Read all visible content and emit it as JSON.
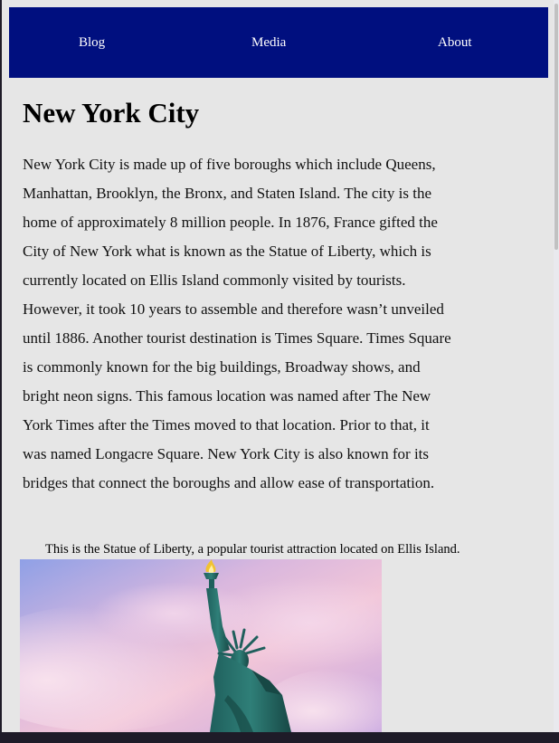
{
  "nav": {
    "blog": "Blog",
    "media": "Media",
    "about": "About"
  },
  "main": {
    "title": "New York City",
    "paragraph": "New York City is made up of five boroughs which include Queens, Manhattan, Brooklyn, the Bronx, and Staten Island. The city is the home of approximately 8 million people. In 1876, France gifted the City of New York what is known as the Statue of Liberty, which is currently located on Ellis Island commonly visited by tourists. However, it took 10 years to assemble and therefore wasn’t unveiled until 1886. Another tourist destination is Times Square. Times Square is commonly known for the big buildings, Broadway shows, and bright neon signs. This famous location was named after The New York Times after the Times moved to that location. Prior to that, it was named Longacre Square. New York City is also known for its bridges that connect the boroughs and allow ease of transportation.",
    "caption": "This is the Statue of Liberty, a popular tourist attraction located on Ellis Island."
  },
  "colors": {
    "nav_background": "#000f7f",
    "page_background": "#e6e6e6",
    "nav_text": "#ffffff"
  }
}
